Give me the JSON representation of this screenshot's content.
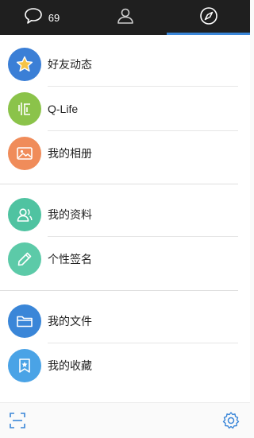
{
  "tabs": {
    "messages": {
      "count": "69",
      "icon": "chat-bubble-icon"
    },
    "contacts": {
      "icon": "person-icon"
    },
    "explore": {
      "icon": "compass-icon",
      "active": true
    }
  },
  "menu": {
    "items": [
      {
        "label": "好友动态",
        "icon": "star-icon",
        "color": "#3b7fd6"
      },
      {
        "label": "Q-Life",
        "icon": "q-life-icon",
        "color": "#8bc34a"
      },
      {
        "label": "我的相册",
        "icon": "photo-icon",
        "color": "#f08c5a"
      },
      {
        "label": "我的资料",
        "icon": "profile-icon",
        "color": "#4fc3a1"
      },
      {
        "label": "个性签名",
        "icon": "pencil-icon",
        "color": "#5ccaa8"
      },
      {
        "label": "我的文件",
        "icon": "folder-icon",
        "color": "#3a86d8"
      },
      {
        "label": "我的收藏",
        "icon": "bookmark-star-icon",
        "color": "#4aa3e6"
      }
    ]
  },
  "footer": {
    "left_icon": "scan-icon",
    "right_icon": "settings-gear-icon",
    "accent": "#3a86d8"
  }
}
